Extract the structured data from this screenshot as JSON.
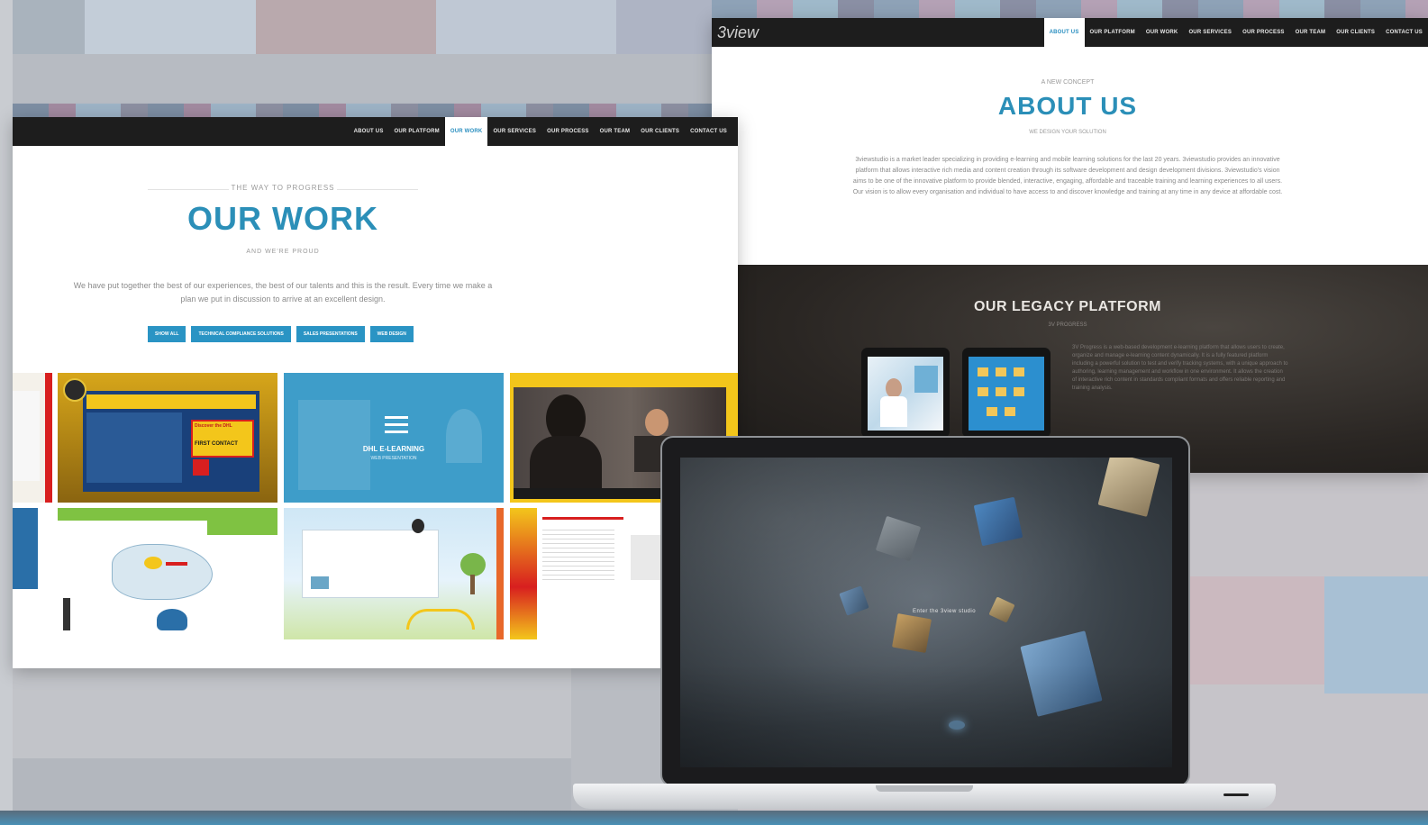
{
  "work_page": {
    "nav": [
      "About us",
      "Our platform",
      "Our work",
      "Our services",
      "Our process",
      "Our team",
      "Our clients",
      "Contact us"
    ],
    "active_index": 2,
    "kicker": "THE WAY TO PROGRESS",
    "title": "OUR WORK",
    "subtitle": "AND WE'RE PROUD",
    "description_line1": "We have put together the best of our experiences, the best of our talents and this is the result. Every time we make a",
    "description_line2": "plan we put in discussion to arrive at an excellent design.",
    "filters": [
      "Show all",
      "Technical compliance solutions",
      "Sales presentations",
      "Web design"
    ],
    "tiles": [
      {
        "label": "",
        "sub": ""
      },
      {
        "label": "",
        "sub": ""
      },
      {
        "label": "DHL E-LEARNING",
        "sub": "WEB PRESENTATION"
      },
      {
        "label": "",
        "sub": ""
      },
      {
        "label": "",
        "sub": ""
      },
      {
        "label": "",
        "sub": ""
      },
      {
        "label": "",
        "sub": ""
      },
      {
        "label": "",
        "sub": ""
      }
    ],
    "tile_badges": {
      "a": "Discover the DHL",
      "b": "FIRST CONTACT"
    }
  },
  "about_page": {
    "logo": "3view",
    "nav": [
      "About us",
      "Our platform",
      "Our work",
      "Our services",
      "Our process",
      "Our team",
      "Our clients",
      "Contact us"
    ],
    "active_index": 0,
    "kicker": "A NEW CONCEPT",
    "title": "ABOUT US",
    "subtitle": "WE DESIGN YOUR SOLUTION",
    "description": "3viewstudio is a market leader specializing in providing e-learning and mobile learning solutions for the last 20 years. 3viewstudio provides an innovative platform that allows interactive rich media and content creation through its software development and design development divisions. 3viewstudio's vision aims to be one of the innovative platform to provide blended, interactive, engaging, affordable and traceable training and learning experiences to all users. Our vision is to allow every organisation and individual to have access to and discover knowledge and training at any time in any device at affordable cost.",
    "legacy_title": "OUR LEGACY PLATFORM",
    "legacy_sub": "3V PROGRESS",
    "legacy_desc": "3V Progress is a web-based development e-learning platform that allows users to create, organize and manage e-learning content dynamically. It is a fully featured platform including a powerful solution to test and verify tracking systems, with a unique approach to authoring, learning management and workflow in one environment. It allows the creation of interactive rich content in standards compliant formats and offers reliable reporting and training analysis."
  },
  "laptop": {
    "enter_label": "Enter the 3view studio"
  },
  "colors": {
    "accent": "#2b8fb8",
    "nav_bg": "#1d1d1d",
    "button": "#2a94c4",
    "dhl_yellow": "#f3c61b",
    "dhl_red": "#d81f1f"
  }
}
